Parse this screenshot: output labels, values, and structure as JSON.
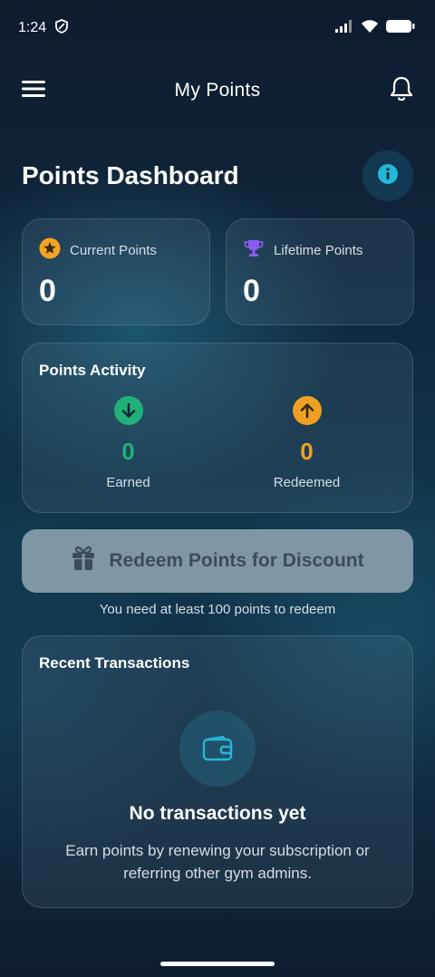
{
  "status_bar": {
    "time": "1:24"
  },
  "app_bar": {
    "title": "My Points"
  },
  "dashboard": {
    "title": "Points Dashboard"
  },
  "stats": {
    "current": {
      "label": "Current Points",
      "value": "0"
    },
    "lifetime": {
      "label": "Lifetime Points",
      "value": "0"
    }
  },
  "activity": {
    "title": "Points Activity",
    "earned": {
      "value": "0",
      "label": "Earned"
    },
    "redeemed": {
      "value": "0",
      "label": "Redeemed"
    }
  },
  "redeem": {
    "button_label": "Redeem Points for Discount",
    "note": "You need at least 100 points to redeem"
  },
  "transactions": {
    "title": "Recent Transactions",
    "empty_title": "No transactions yet",
    "empty_description": "Earn points by renewing your subscription or referring other gym admins."
  },
  "colors": {
    "accent_cyan": "#22b8d8",
    "earned_green": "#22b07a",
    "redeemed_orange": "#f0a020",
    "star_gold": "#f2a423",
    "trophy_purple": "#8a5cf0"
  },
  "icons": [
    "shield-icon",
    "signal-icon",
    "wifi-icon",
    "battery-icon",
    "menu-icon",
    "bell-icon",
    "info-icon",
    "star-icon",
    "trophy-icon",
    "arrow-down-icon",
    "arrow-up-icon",
    "gift-icon",
    "wallet-icon"
  ]
}
